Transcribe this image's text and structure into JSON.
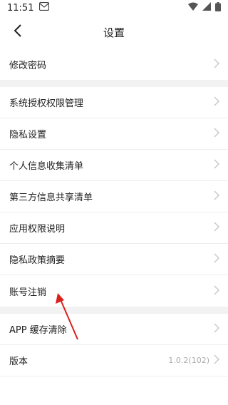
{
  "status_bar": {
    "time": "11:51"
  },
  "header": {
    "title": "设置"
  },
  "groups": [
    {
      "items": [
        {
          "label": "修改密码",
          "value": ""
        }
      ]
    },
    {
      "items": [
        {
          "label": "系统授权权限管理",
          "value": ""
        },
        {
          "label": "隐私设置",
          "value": ""
        },
        {
          "label": "个人信息收集清单",
          "value": ""
        },
        {
          "label": "第三方信息共享清单",
          "value": ""
        },
        {
          "label": "应用权限说明",
          "value": ""
        },
        {
          "label": "隐私政策摘要",
          "value": ""
        },
        {
          "label": "账号注销",
          "value": ""
        }
      ]
    },
    {
      "items": [
        {
          "label": "APP 缓存清除",
          "value": ""
        },
        {
          "label": "版本",
          "value": "1.0.2(102)"
        }
      ]
    }
  ],
  "icons": {
    "back": "chevron-left-icon",
    "row_chevron": "chevron-right-icon",
    "notification": "mail-icon",
    "wifi": "wifi-icon",
    "signal": "signal-icon",
    "battery": "battery-icon"
  },
  "colors": {
    "annotation_arrow": "#d9211d",
    "separator": "#f2f2f2",
    "chevron": "#c4c4c4"
  }
}
